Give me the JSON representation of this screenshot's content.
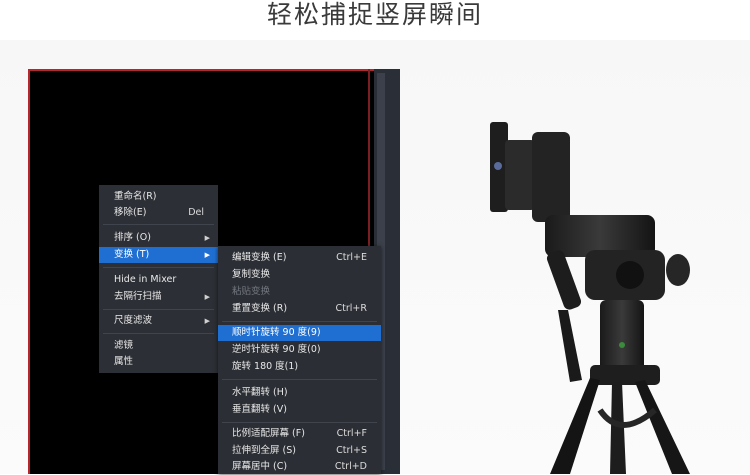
{
  "headline": "轻松捕捉竖屏瞬间",
  "main_menu": [
    {
      "label": "重命名(R)",
      "shortcut": ""
    },
    {
      "label": "移除(E)",
      "shortcut": "Del"
    },
    {
      "label": "排序 (O)",
      "shortcut": ""
    },
    {
      "label": "变换 (T)",
      "shortcut": ""
    },
    {
      "label": "Hide in Mixer",
      "shortcut": ""
    },
    {
      "label": "去隔行扫描",
      "shortcut": ""
    },
    {
      "label": "尺度滤波",
      "shortcut": ""
    },
    {
      "label": "滤镜",
      "shortcut": ""
    },
    {
      "label": "属性",
      "shortcut": ""
    }
  ],
  "sub_menu": [
    {
      "label": "编辑变换 (E)",
      "shortcut": "Ctrl+E"
    },
    {
      "label": "复制变换",
      "shortcut": ""
    },
    {
      "label": "粘贴变换",
      "shortcut": ""
    },
    {
      "label": "重置变换 (R)",
      "shortcut": "Ctrl+R"
    },
    {
      "label": "顺时针旋转 90 度(9)",
      "shortcut": ""
    },
    {
      "label": "逆时针旋转 90 度(0)",
      "shortcut": ""
    },
    {
      "label": "旋转 180 度(1)",
      "shortcut": ""
    },
    {
      "label": "水平翻转 (H)",
      "shortcut": ""
    },
    {
      "label": "垂直翻转 (V)",
      "shortcut": ""
    },
    {
      "label": "比例适配屏幕 (F)",
      "shortcut": "Ctrl+F"
    },
    {
      "label": "拉伸到全屏 (S)",
      "shortcut": "Ctrl+S"
    },
    {
      "label": "屏幕居中 (C)",
      "shortcut": "Ctrl+D"
    }
  ],
  "colors": {
    "menu_bg": "#2c2f35",
    "highlight": "#1f6fd2",
    "preview_border": "#b8262b"
  },
  "icons": {
    "submenu_arrow": "triangle-right-icon"
  }
}
